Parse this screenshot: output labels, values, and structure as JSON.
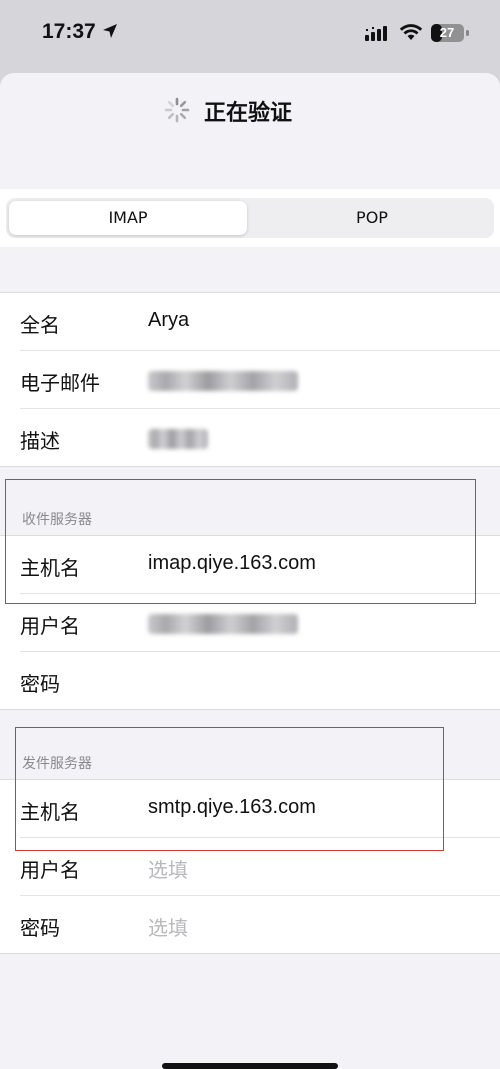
{
  "status_bar": {
    "time": "17:37",
    "battery": "27",
    "icons": [
      "location-arrow-icon",
      "signal-icon",
      "wifi-icon",
      "battery-icon"
    ]
  },
  "nav": {
    "title": "正在验证",
    "spinner_icon": "activity-spinner-icon"
  },
  "segmented": {
    "options": [
      "IMAP",
      "POP"
    ],
    "selected": "IMAP"
  },
  "account": {
    "rows": [
      {
        "label": "全名",
        "value": "Arya"
      },
      {
        "label": "电子邮件",
        "value": "arya@4cosy.cn"
      },
      {
        "label": "描述",
        "value": "4cosy"
      }
    ]
  },
  "incoming": {
    "header": "收件服务器",
    "rows": [
      {
        "label": "主机名",
        "value": "imap.qiye.163.com"
      },
      {
        "label": "用户名",
        "value": "arya@4cosy.cn"
      },
      {
        "label": "密码",
        "value": ""
      }
    ]
  },
  "outgoing": {
    "header": "发件服务器",
    "rows": [
      {
        "label": "主机名",
        "value": "smtp.qiye.163.com"
      },
      {
        "label": "用户名",
        "placeholder": "选填"
      },
      {
        "label": "密码",
        "placeholder": "选填"
      }
    ]
  },
  "colors": {
    "highlight_box": "#cf3b36",
    "placeholder": "#b8b8bd",
    "section_header": "#8a8a8e"
  }
}
